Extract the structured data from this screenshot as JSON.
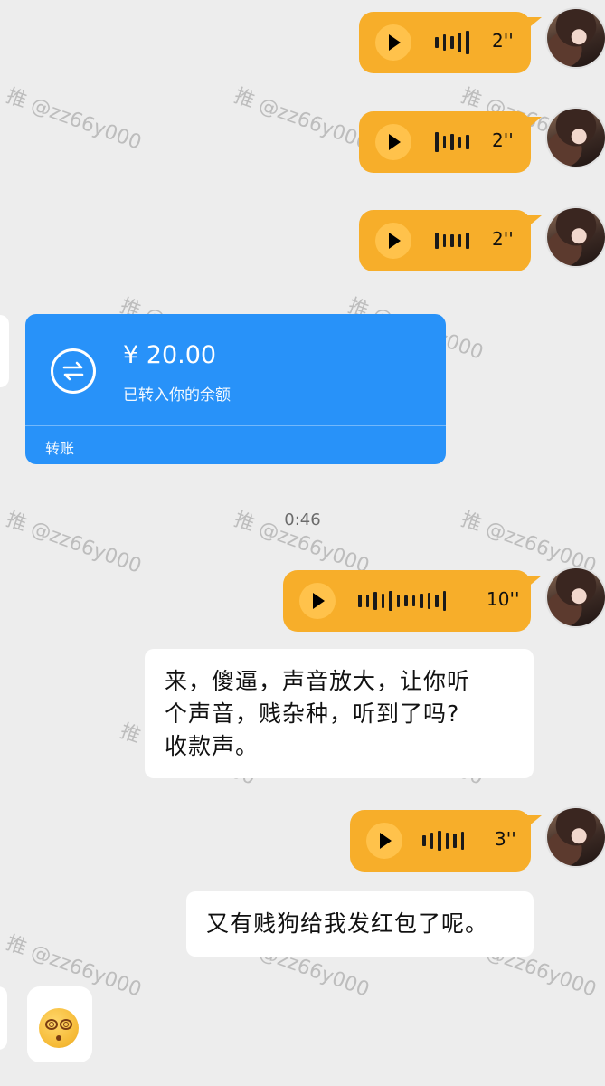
{
  "watermark": "推 @zz66y000",
  "messages": {
    "voice1": {
      "duration": "2''"
    },
    "voice2": {
      "duration": "2''"
    },
    "voice3": {
      "duration": "2''"
    },
    "transfer": {
      "amount": "¥ 20.00",
      "status": "已转入你的余额",
      "label": "转账"
    },
    "timestamp": "0:46",
    "voice4": {
      "duration": "10''"
    },
    "text1": {
      "lines": [
        "来，傻逼，声音放大，让你听",
        "个声音，贱杂种，听到了吗?",
        "收款声。"
      ]
    },
    "voice5": {
      "duration": "3''"
    },
    "text2": {
      "text": "又有贱狗给我发红包了呢。"
    },
    "emoji": {
      "name": "dizzy-face-emoji"
    }
  },
  "colors": {
    "background": "#ededed",
    "voice_bubble": "#f7ae2a",
    "transfer_card": "#2892f9",
    "text_bubble": "#ffffff"
  }
}
